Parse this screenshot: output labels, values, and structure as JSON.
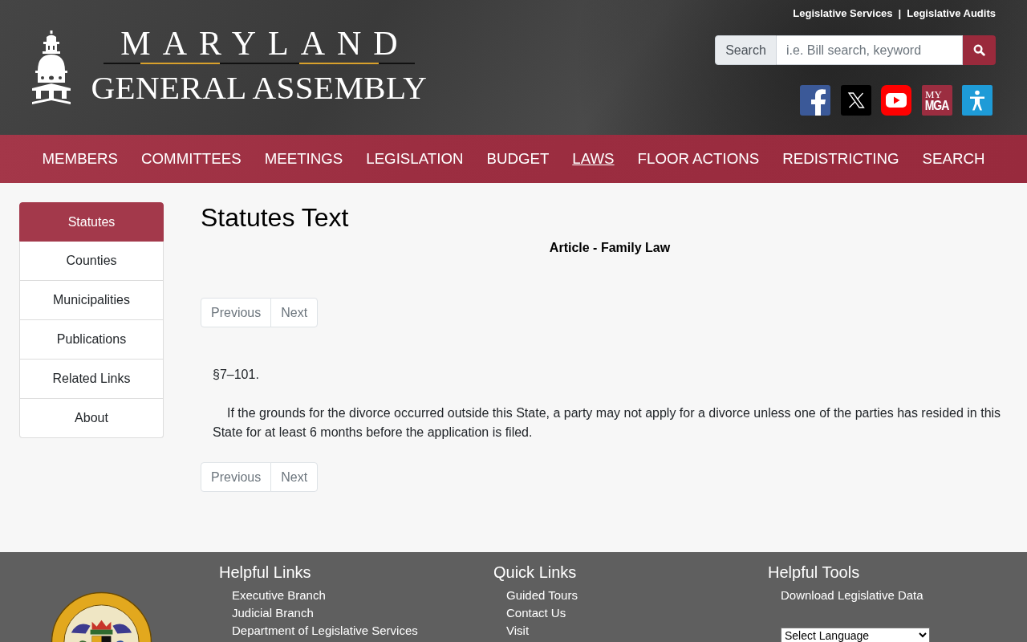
{
  "header": {
    "top_links": [
      {
        "label": "Legislative Services"
      },
      {
        "label": "Legislative Audits"
      }
    ],
    "top_links_separator": "|",
    "logo": {
      "line_1": "MARYLAND",
      "line_2": "GENERAL ASSEMBLY"
    },
    "search": {
      "addon": "Search",
      "placeholder": "i.e. Bill search, keyword"
    },
    "social_links": [
      {
        "kind": "facebook"
      },
      {
        "kind": "x"
      },
      {
        "kind": "youtube"
      },
      {
        "kind": "mymga",
        "label_top": "MY",
        "label_bottom": "MGA"
      },
      {
        "kind": "accessibility"
      }
    ]
  },
  "nav": {
    "items": [
      {
        "label": "MEMBERS",
        "selected": false
      },
      {
        "label": "COMMITTEES",
        "selected": false
      },
      {
        "label": "MEETINGS",
        "selected": false
      },
      {
        "label": "LEGISLATION",
        "selected": false
      },
      {
        "label": "BUDGET",
        "selected": false
      },
      {
        "label": "LAWS",
        "selected": true
      },
      {
        "label": "FLOOR ACTIONS",
        "selected": false
      },
      {
        "label": "REDISTRICTING",
        "selected": false
      },
      {
        "label": "SEARCH",
        "selected": false
      }
    ]
  },
  "sidebar": {
    "items": [
      {
        "label": "Statutes",
        "selected": true
      },
      {
        "label": "Counties",
        "selected": false
      },
      {
        "label": "Municipalities",
        "selected": false
      },
      {
        "label": "Publications",
        "selected": false
      },
      {
        "label": "Related Links",
        "selected": false
      },
      {
        "label": "About",
        "selected": false
      }
    ]
  },
  "main": {
    "title": "Statutes Text",
    "subtitle": "Article - Family Law",
    "pagination_top": [
      {
        "label": "Previous",
        "disabled": true
      },
      {
        "label": "Next",
        "disabled": true
      }
    ],
    "section_number": "§7–101.",
    "paragraph": "If the grounds for the divorce occurred outside this State, a party may not apply for a divorce unless one of the parties has resided in this State for at least 6 months before the application is filed.",
    "pagination_bottom": [
      {
        "label": "Previous",
        "disabled": true
      },
      {
        "label": "Next",
        "disabled": true
      }
    ]
  },
  "footer": {
    "columns": [
      {
        "heading": "Helpful Links",
        "links": [
          "Executive Branch",
          "Judicial Branch",
          "Department of Legislative Services"
        ]
      },
      {
        "heading": "Quick Links",
        "links": [
          "Guided Tours",
          "Contact Us",
          "Visit"
        ]
      },
      {
        "heading": "Helpful Tools",
        "links": [
          "Download Legislative Data"
        ],
        "language_select": "Select Language"
      }
    ]
  }
}
